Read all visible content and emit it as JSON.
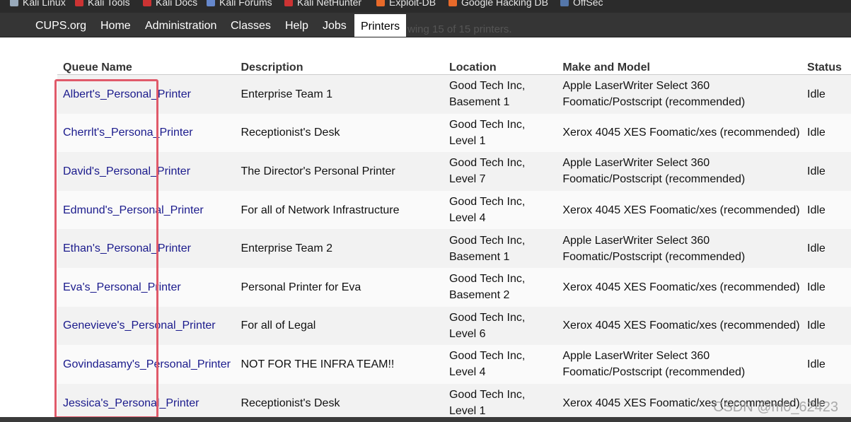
{
  "bookmarks": [
    {
      "label": "Kali Linux",
      "icon": "kali-dragon-icon"
    },
    {
      "label": "Kali Tools",
      "icon": "kali-tools-icon"
    },
    {
      "label": "Kali Docs",
      "icon": "kali-docs-icon"
    },
    {
      "label": "Kali Forums",
      "icon": "kali-forums-icon"
    },
    {
      "label": "Kali NetHunter",
      "icon": "nethunter-icon"
    },
    {
      "label": "Exploit-DB",
      "icon": "exploit-db-icon"
    },
    {
      "label": "Google Hacking DB",
      "icon": "ghdb-icon"
    },
    {
      "label": "OffSec",
      "icon": "offsec-icon"
    }
  ],
  "nav": {
    "items": [
      "CUPS.org",
      "Home",
      "Administration",
      "Classes",
      "Help",
      "Jobs",
      "Printers"
    ],
    "active": "Printers",
    "ghost_text": "wing 15 of 15 printers."
  },
  "table": {
    "headers": [
      "Queue Name",
      "Description",
      "Location",
      "Make and Model",
      "Status"
    ],
    "rows": [
      {
        "queue": "Albert's_Personal_Printer",
        "description": "Enterprise Team 1",
        "location": [
          "Good Tech Inc,",
          "Basement 1"
        ],
        "model": [
          "Apple LaserWriter Select 360",
          "Foomatic/Postscript (recommended)"
        ],
        "status": "Idle"
      },
      {
        "queue": "Cherrlt's_Persona_Printer",
        "description": "Receptionist's Desk",
        "location": [
          "Good Tech Inc,",
          "Level 1"
        ],
        "model": [
          "Xerox 4045 XES Foomatic/xes (recommended)"
        ],
        "status": "Idle"
      },
      {
        "queue": "David's_Personal_Printer",
        "description": "The Director's Personal Printer",
        "location": [
          "Good Tech Inc,",
          "Level 7"
        ],
        "model": [
          "Apple LaserWriter Select 360",
          "Foomatic/Postscript (recommended)"
        ],
        "status": "Idle"
      },
      {
        "queue": "Edmund's_Personal_Printer",
        "description": "For all of Network Infrastructure",
        "location": [
          "Good Tech Inc,",
          "Level 4"
        ],
        "model": [
          "Xerox 4045 XES Foomatic/xes (recommended)"
        ],
        "status": "Idle"
      },
      {
        "queue": "Ethan's_Personal_Printer",
        "description": "Enterprise Team 2",
        "location": [
          "Good Tech Inc,",
          "Basement 1"
        ],
        "model": [
          "Apple LaserWriter Select 360",
          "Foomatic/Postscript (recommended)"
        ],
        "status": "Idle"
      },
      {
        "queue": "Eva's_Personal_Printer",
        "description": "Personal Printer for Eva",
        "location": [
          "Good Tech Inc,",
          "Basement 2"
        ],
        "model": [
          "Xerox 4045 XES Foomatic/xes (recommended)"
        ],
        "status": "Idle"
      },
      {
        "queue": "Genevieve's_Personal_Printer",
        "description": "For all of Legal",
        "location": [
          "Good Tech Inc,",
          "Level 6"
        ],
        "model": [
          "Xerox 4045 XES Foomatic/xes (recommended)"
        ],
        "status": "Idle"
      },
      {
        "queue": "Govindasamy's_Personal_Printer",
        "description": "NOT FOR THE INFRA TEAM!!",
        "location": [
          "Good Tech Inc,",
          "Level 4"
        ],
        "model": [
          "Apple LaserWriter Select 360",
          "Foomatic/Postscript (recommended)"
        ],
        "status": "Idle"
      },
      {
        "queue": "Jessica's_Personal_Printer",
        "description": "Receptionist's Desk",
        "location": [
          "Good Tech Inc,",
          "Level 1"
        ],
        "model": [
          "Xerox 4045 XES Foomatic/xes (recommended)"
        ],
        "status": "Idle"
      }
    ]
  },
  "watermark": "CSDN @m0_62423",
  "colors": {
    "highlight": "#e05a6a",
    "link": "#1a1a8c",
    "navbar": "#353535"
  }
}
